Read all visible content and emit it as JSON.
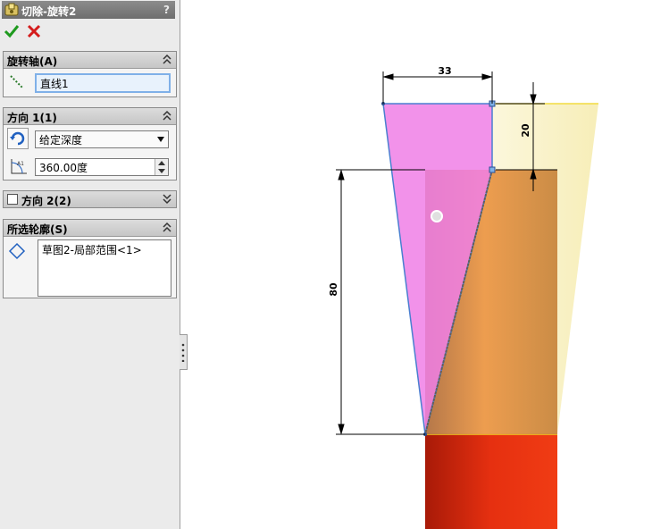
{
  "title": "切除-旋转2",
  "help_symbol": "?",
  "actions": {
    "ok": "ok-check",
    "cancel": "cancel-x"
  },
  "rotation_axis": {
    "header": "旋转轴(A)",
    "value": "直线1"
  },
  "direction1": {
    "header": "方向 1(1)",
    "end_condition": "给定深度",
    "angle": "360.00度"
  },
  "direction2": {
    "header": "方向 2(2)",
    "checked": false
  },
  "contours": {
    "header": "所选轮廓(S)",
    "items": [
      "草图2-局部范围<1>"
    ]
  },
  "dimensions": {
    "top_width": "33",
    "top_offset": "20",
    "height": "80"
  },
  "colors": {
    "pink_profile": "#f07fe6",
    "orange_body": "#e8963c",
    "yellow_preview": "#f8f2c6",
    "red_body": "#e02810",
    "edge_blue": "#4a7fd0"
  }
}
